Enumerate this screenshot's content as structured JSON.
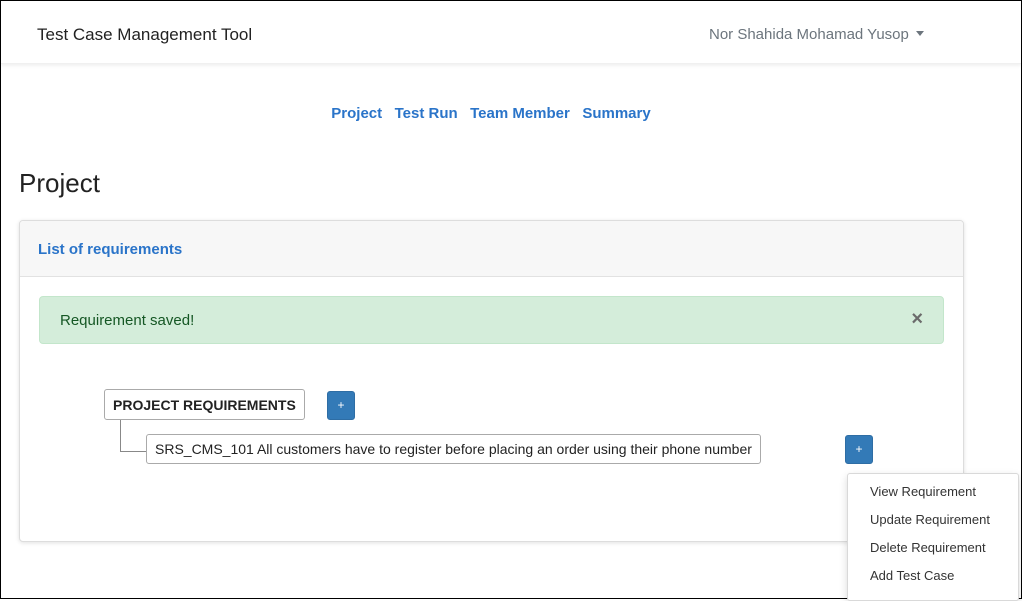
{
  "header": {
    "app_title": "Test Case Management Tool",
    "user_name": "Nor Shahida Mohamad Yusop"
  },
  "nav": {
    "items": [
      {
        "label": "Project"
      },
      {
        "label": "Test Run"
      },
      {
        "label": "Team Member"
      },
      {
        "label": "Summary"
      }
    ]
  },
  "page": {
    "title": "Project"
  },
  "card": {
    "header_link": "List of requirements",
    "alert": {
      "message": "Requirement saved!",
      "close_glyph": "×"
    },
    "tree": {
      "root_label": "PROJECT REQUIREMENTS",
      "add_glyph": "+",
      "children": [
        {
          "label": "SRS_CMS_101  All customers have to register before placing an order using their phone number"
        }
      ]
    }
  },
  "dropdown": {
    "items": [
      {
        "label": "View Requirement"
      },
      {
        "label": "Update Requirement"
      },
      {
        "label": "Delete Requirement"
      },
      {
        "label": "Add Test Case"
      }
    ]
  },
  "colors": {
    "link": "#2a74c9",
    "alert_bg": "#d4edda",
    "alert_text": "#155724",
    "button_primary": "#337ab7"
  }
}
